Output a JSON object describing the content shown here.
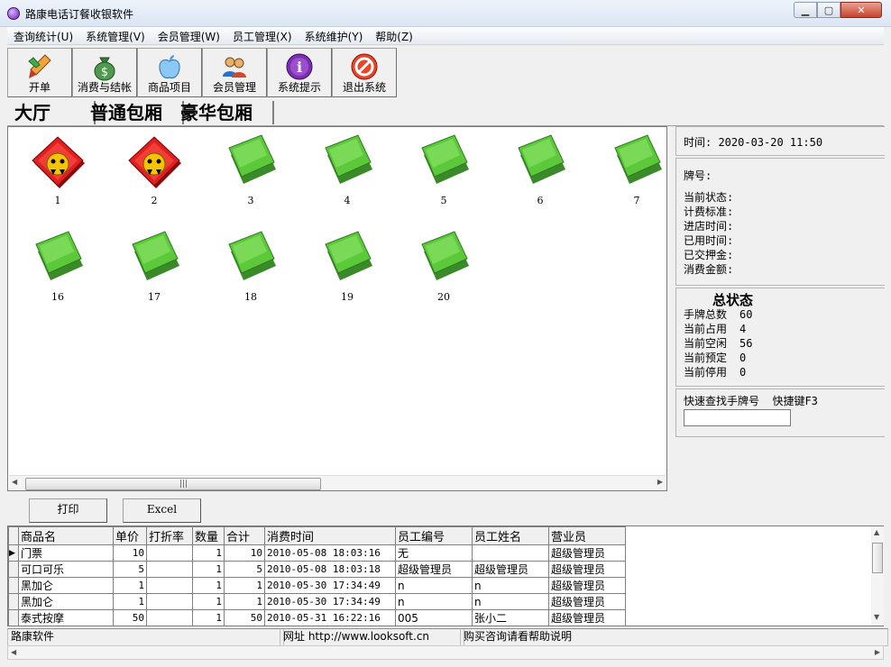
{
  "window": {
    "title": "路康电话订餐收银软件",
    "min": "▁",
    "max": "▢",
    "close": "✕"
  },
  "menu": [
    "查询统计(U)",
    "系统管理(V)",
    "会员管理(W)",
    "员工管理(X)",
    "系统维护(Y)",
    "帮助(Z)"
  ],
  "toolbar": [
    {
      "label": "开单",
      "icon": "brush-icon"
    },
    {
      "label": "消费与结帐",
      "icon": "money-bag-icon"
    },
    {
      "label": "商品项目",
      "icon": "apple-icon"
    },
    {
      "label": "会员管理",
      "icon": "members-icon"
    },
    {
      "label": "系统提示",
      "icon": "info-icon"
    },
    {
      "label": "退出系统",
      "icon": "no-entry-icon"
    }
  ],
  "tabs": [
    "大厅",
    "普通包厢",
    "豪华包厢"
  ],
  "rooms": [
    {
      "num": "1",
      "state": "occupied"
    },
    {
      "num": "2",
      "state": "occupied"
    },
    {
      "num": "3",
      "state": "free"
    },
    {
      "num": "4",
      "state": "free"
    },
    {
      "num": "5",
      "state": "free"
    },
    {
      "num": "6",
      "state": "free"
    },
    {
      "num": "7",
      "state": "free"
    },
    {
      "num": "16",
      "state": "free"
    },
    {
      "num": "17",
      "state": "free"
    },
    {
      "num": "18",
      "state": "free"
    },
    {
      "num": "19",
      "state": "free"
    },
    {
      "num": "20",
      "state": "free"
    }
  ],
  "info": {
    "time": "时间: 2020-03-20 11:50",
    "card_no": "牌号:",
    "status": "当前状态:",
    "rate": "计费标准:",
    "entry": "进店时间:",
    "used": "已用时间:",
    "deposit": "已交押金:",
    "amount": "消费金额:"
  },
  "summary": {
    "title": "总状态",
    "rows": [
      {
        "label": "手牌总数",
        "value": "60"
      },
      {
        "label": "当前占用",
        "value": "4"
      },
      {
        "label": "当前空闲",
        "value": "56"
      },
      {
        "label": "当前预定",
        "value": "0"
      },
      {
        "label": "当前停用",
        "value": "0"
      }
    ]
  },
  "search": {
    "label": "快速查找手牌号  快捷键F3",
    "value": ""
  },
  "buttons": {
    "print": "打印",
    "excel": "Excel"
  },
  "grid": {
    "columns": [
      "商品名",
      "单价",
      "打折率",
      "数量",
      "合计",
      "消费时间",
      "员工编号",
      "员工姓名",
      "营业员"
    ],
    "rows": [
      [
        "门票",
        "10",
        "",
        "1",
        "10",
        "2010-05-08 18:03:16",
        "无",
        "",
        "超级管理员"
      ],
      [
        "可口可乐",
        "5",
        "",
        "1",
        "5",
        "2010-05-08 18:03:18",
        "超级管理员",
        "超级管理员",
        "超级管理员"
      ],
      [
        "黑加仑",
        "1",
        "",
        "1",
        "1",
        "2010-05-30 17:34:49",
        "n",
        "n",
        "超级管理员"
      ],
      [
        "黑加仑",
        "1",
        "",
        "1",
        "1",
        "2010-05-30 17:34:49",
        "n",
        "n",
        "超级管理员"
      ],
      [
        "泰式按摩",
        "50",
        "",
        "1",
        "50",
        "2010-05-31 16:22:16",
        "005",
        "张小二",
        "超级管理员"
      ]
    ]
  },
  "status": [
    "路康软件",
    "网址 http://www.looksoft.cn",
    "购买咨询请看帮助说明"
  ],
  "colors": {
    "occupied": "#e02020",
    "free": "#5cc93a"
  }
}
